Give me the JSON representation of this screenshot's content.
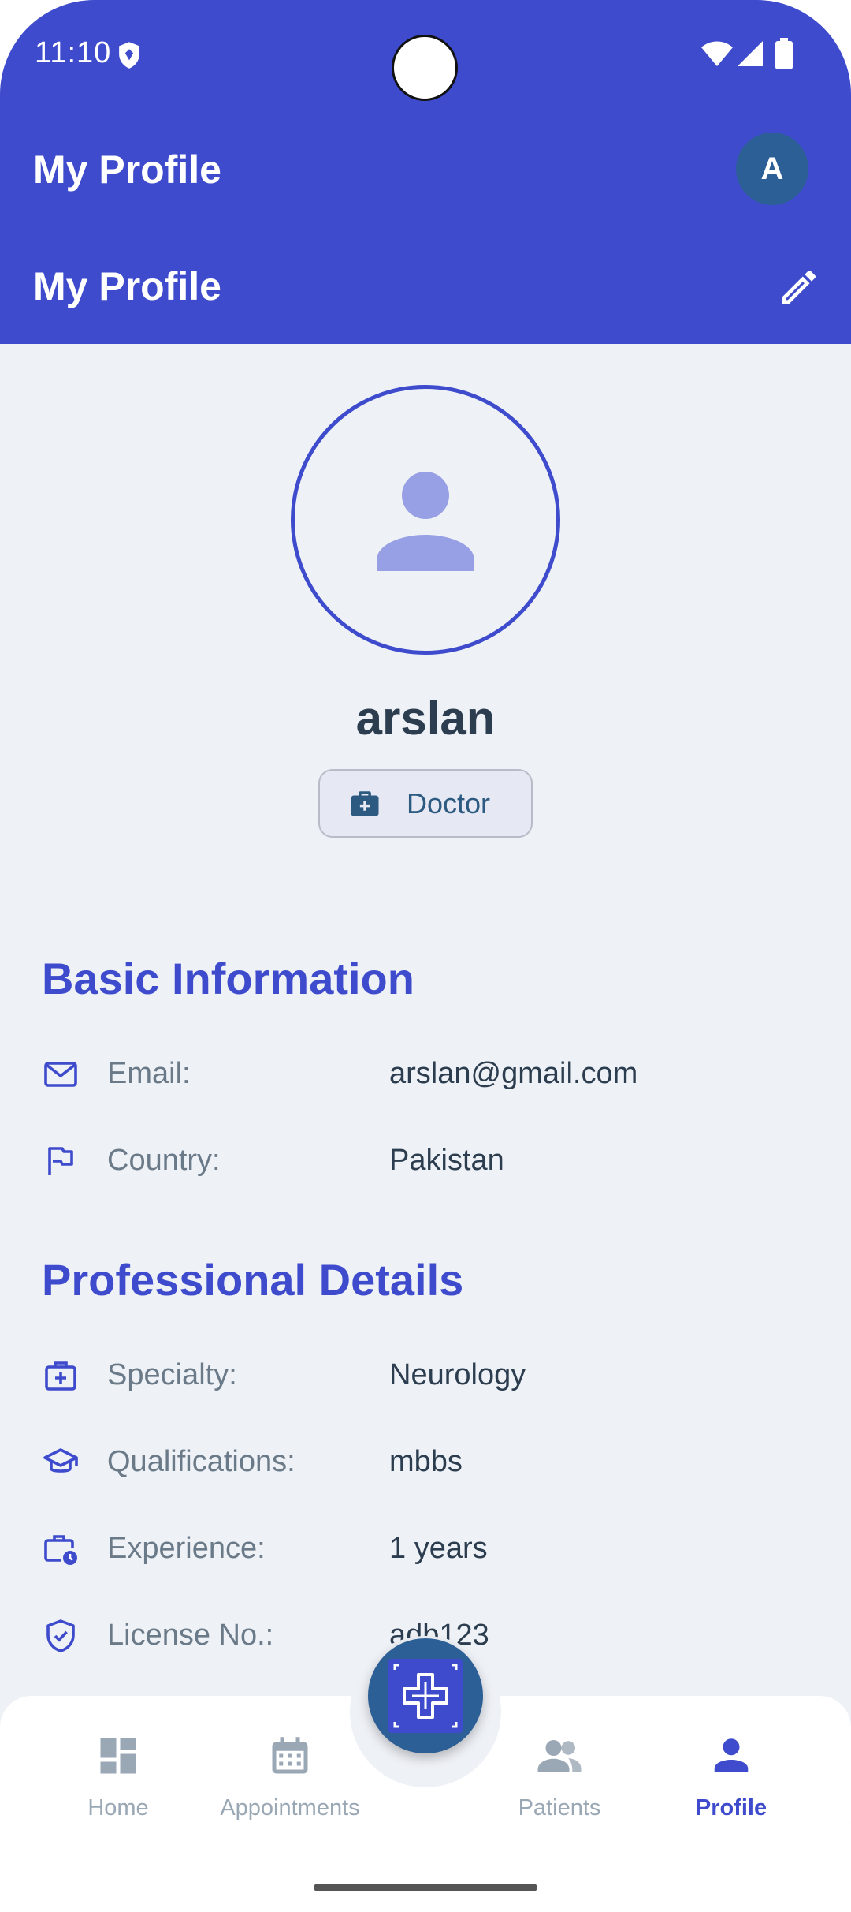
{
  "status_bar": {
    "time": "11:10"
  },
  "app_bar": {
    "title": "My Profile",
    "avatar_initial": "A"
  },
  "sub_bar": {
    "title": "My Profile"
  },
  "profile": {
    "name": "arslan",
    "role": "Doctor"
  },
  "basic_info": {
    "heading": "Basic Information",
    "rows": [
      {
        "label": "Email:",
        "value": "arslan@gmail.com",
        "icon": "mail-icon"
      },
      {
        "label": "Country:",
        "value": "Pakistan",
        "icon": "flag-icon"
      }
    ]
  },
  "professional": {
    "heading": "Professional Details",
    "rows": [
      {
        "label": "Specialty:",
        "value": "Neurology",
        "icon": "medical-bag-icon"
      },
      {
        "label": "Qualifications:",
        "value": "mbbs",
        "icon": "graduation-cap-icon"
      },
      {
        "label": "Experience:",
        "value": "1 years",
        "icon": "briefcase-clock-icon"
      },
      {
        "label": "License No.:",
        "value": "adb123",
        "icon": "shield-check-icon"
      }
    ]
  },
  "nav": {
    "items": [
      {
        "label": "Home",
        "icon": "dashboard-icon"
      },
      {
        "label": "Appointments",
        "icon": "calendar-icon"
      },
      {
        "label": "Patients",
        "icon": "people-icon"
      },
      {
        "label": "Profile",
        "icon": "person-icon",
        "active": true
      }
    ]
  },
  "colors": {
    "primary": "#3d4bcc",
    "accent_dark": "#2c5f96",
    "text_dark": "#2b3d4f",
    "text_muted": "#6b7a88"
  }
}
